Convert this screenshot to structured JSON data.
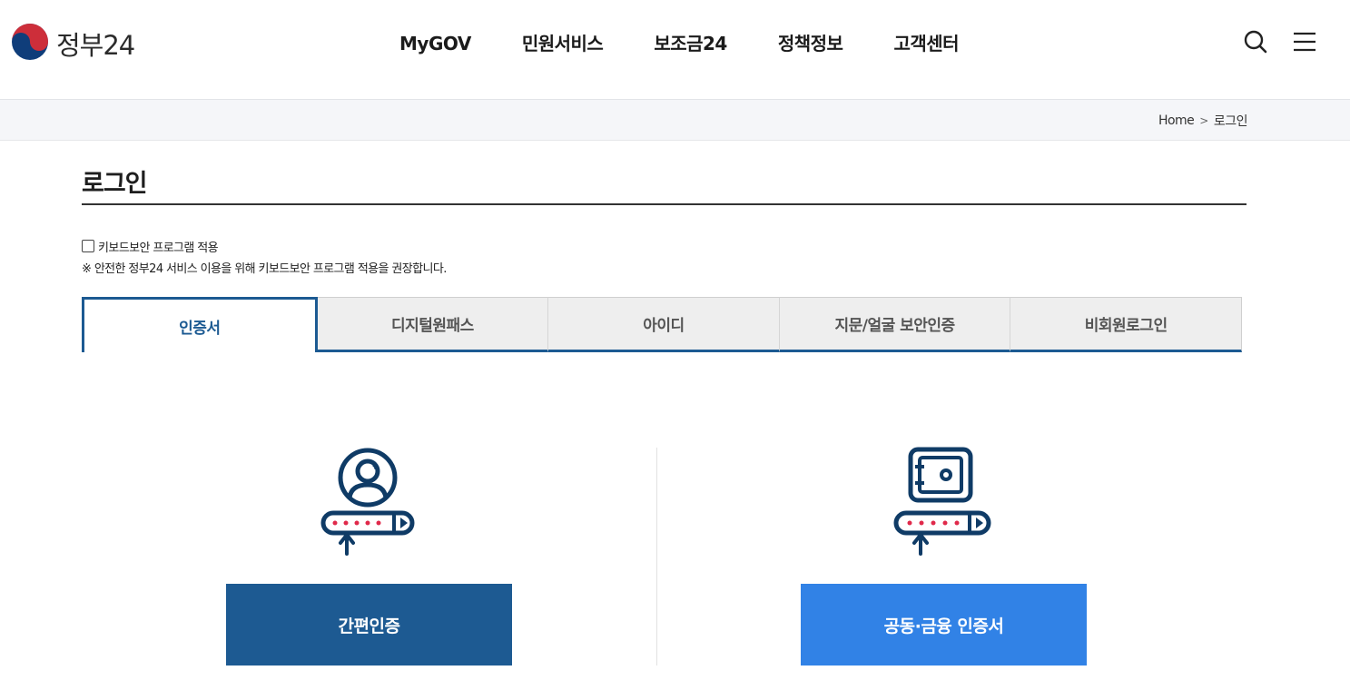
{
  "header": {
    "logo_text": "정부24",
    "logo_icon": "taegeuk-icon",
    "nav": [
      {
        "label": "MyGOV"
      },
      {
        "label": "민원서비스"
      },
      {
        "label": "보조금24"
      },
      {
        "label": "정책정보"
      },
      {
        "label": "고객센터"
      }
    ],
    "search_icon": "search-icon",
    "menu_icon": "hamburger-menu-icon"
  },
  "breadcrumb": {
    "home": "Home",
    "separator": ">",
    "current": "로그인"
  },
  "page": {
    "title": "로그인"
  },
  "keyboard_security": {
    "checkbox_label": "키보드보안 프로그램 적용",
    "checked": false,
    "note": "※ 안전한 정부24 서비스 이용을 위해 키보드보안 프로그램 적용을 권장합니다."
  },
  "tabs": [
    {
      "label": "인증서",
      "active": true
    },
    {
      "label": "디지털원패스",
      "active": false
    },
    {
      "label": "아이디",
      "active": false
    },
    {
      "label": "지문/얼굴 보안인증",
      "active": false
    },
    {
      "label": "비회원로그인",
      "active": false
    }
  ],
  "auth_options": [
    {
      "icon": "user-password-icon",
      "button_label": "간편인증"
    },
    {
      "icon": "safe-password-icon",
      "button_label": "공동·금융 인증서"
    }
  ],
  "colors": {
    "primary": "#1d5a92",
    "accent": "#3182e6",
    "logo_red": "#cd2e3a",
    "logo_blue": "#0f3d7a",
    "password_dots": "#e0294a"
  }
}
